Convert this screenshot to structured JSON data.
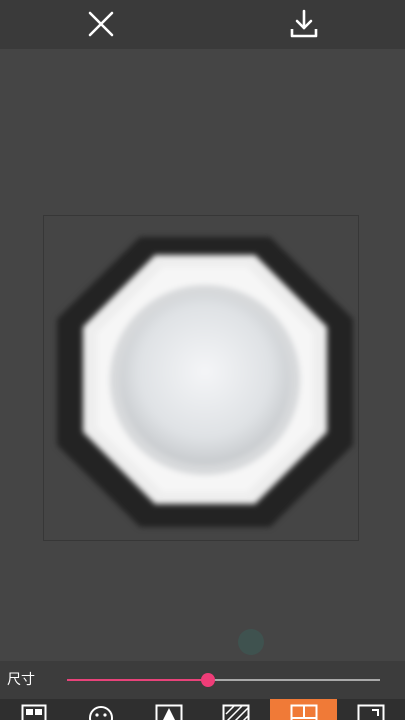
{
  "topbar": {
    "close_icon": "close-icon",
    "download_icon": "download-icon"
  },
  "sticker": {
    "shape": "octagon-badge",
    "colors": {
      "fill": "#f2f2f2",
      "shadow": "#1d1d1d",
      "center": "#dfe2e5"
    }
  },
  "size_control": {
    "label": "尺寸",
    "value": 0.45,
    "colors": {
      "active": "#e8437a",
      "inactive": "#a9a9a9"
    }
  },
  "toolbar": {
    "active_index": 4,
    "active_color": "#f07a37",
    "tools": [
      {
        "icon": "layout-grid-icon"
      },
      {
        "icon": "emoji-face-icon"
      },
      {
        "icon": "shape-icon"
      },
      {
        "icon": "texture-icon"
      },
      {
        "icon": "split-layout-icon"
      },
      {
        "icon": "crop-icon"
      }
    ]
  }
}
